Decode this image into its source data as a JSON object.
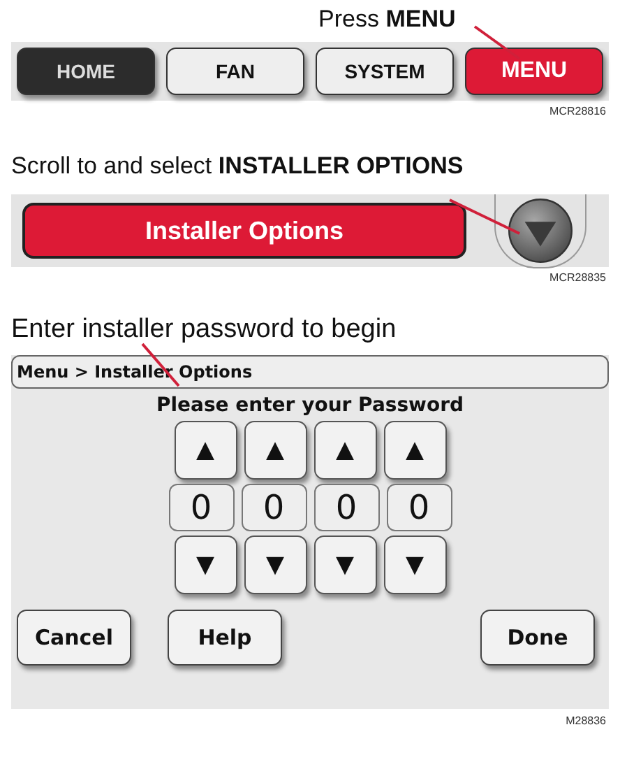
{
  "step1": {
    "instruction": "Press **MENU**",
    "tabs": [
      {
        "label": "HOME",
        "kind": "dark"
      },
      {
        "label": "FAN",
        "kind": "light"
      },
      {
        "label": "SYSTEM",
        "kind": "light"
      },
      {
        "label": "MENU",
        "kind": "red"
      }
    ],
    "figure_code": "MCR28816"
  },
  "step2": {
    "instruction": "Scroll to and select **INSTALLER OPTIONS**",
    "option": "Installer Options",
    "figure_code": "MCR28835"
  },
  "step3": {
    "instruction": "Enter installer password to begin",
    "breadcrumb": "Menu > Installer Options",
    "prompt": "Please enter your Password",
    "up_keys": [
      "▲",
      "▲",
      "▲",
      "▲"
    ],
    "digits": [
      "0",
      "0",
      "0",
      "0"
    ],
    "down_keys": [
      "▼",
      "▼",
      "▼",
      "▼"
    ],
    "buttons": [
      "Cancel",
      "Help",
      "Done"
    ],
    "figure_code": "M28836"
  }
}
